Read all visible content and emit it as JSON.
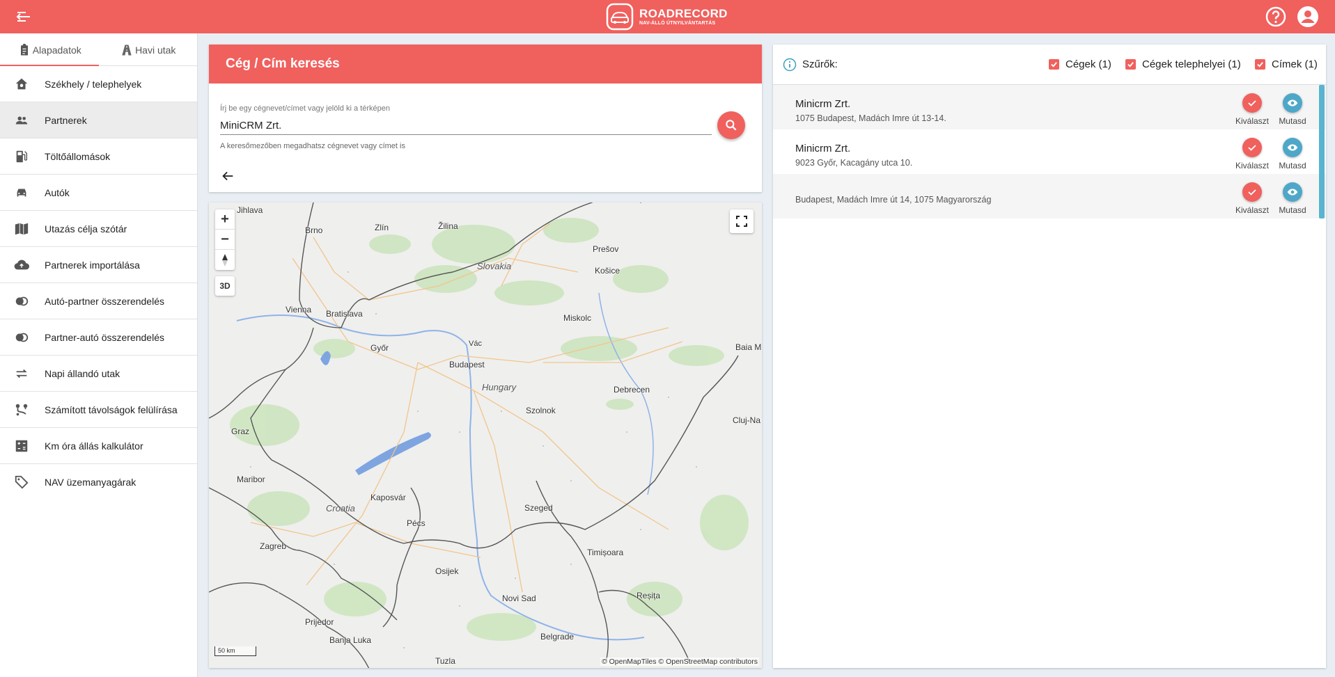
{
  "header": {
    "brand_title": "ROADRECORD",
    "brand_subtitle": "NAV-ÁLLÓ ÚTNYILVÁNTARTÁS",
    "back_icon": "menu-collapse-icon",
    "help_icon": "help-circle-icon",
    "account_icon": "account-circle-icon",
    "accent_color": "#f0605d"
  },
  "sidebar": {
    "tabs": [
      {
        "label": "Alapadatok",
        "icon": "clipboard-icon",
        "active": true
      },
      {
        "label": "Havi utak",
        "icon": "road-icon",
        "active": false
      }
    ],
    "items": [
      {
        "label": "Székhely / telephelyek",
        "icon": "home-gear-icon"
      },
      {
        "label": "Partnerek",
        "icon": "people-icon",
        "active": true
      },
      {
        "label": "Töltőállomások",
        "icon": "fuel-icon"
      },
      {
        "label": "Autók",
        "icon": "car-icon"
      },
      {
        "label": "Utazás célja szótár",
        "icon": "book-icon"
      },
      {
        "label": "Partnerek importálása",
        "icon": "cloud-upload-icon"
      },
      {
        "label": "Autó-partner összerendelés",
        "icon": "link-circles-icon"
      },
      {
        "label": "Partner-autó összerendelés",
        "icon": "link-circles-icon"
      },
      {
        "label": "Napi állandó utak",
        "icon": "repeat-icon"
      },
      {
        "label": "Számított távolságok felülírása",
        "icon": "route-icon"
      },
      {
        "label": "Km óra állás kalkulátor",
        "icon": "calculator-icon"
      },
      {
        "label": "NAV üzemanyagárak",
        "icon": "tag-icon"
      }
    ]
  },
  "search": {
    "title": "Cég / Cím keresés",
    "hint": "Írj be egy cégnevet/címet vagy jelöld ki a térképen",
    "value": "MiniCRM Zrt.",
    "helper": "A keresőmezőben megadhatsz cégnevet vagy címet is"
  },
  "map": {
    "countries": [
      "Slovakia",
      "Hungary",
      "Croatia"
    ],
    "cities": [
      "Jihlava",
      "Brno",
      "Zlín",
      "Žilina",
      "Prešov",
      "Košice",
      "Vienna",
      "Bratislava",
      "Miskolc",
      "Vác",
      "Győr",
      "Budapest",
      "Debrecen",
      "Baia M",
      "Graz",
      "Hungary",
      "Szolnok",
      "Cluj-Na",
      "Maribor",
      "Kaposvár",
      "Pécs",
      "Szeged",
      "Zagreb",
      "Timișoara",
      "Osijek",
      "Reșița",
      "Novi Sad",
      "Prijedor",
      "Banja Luka",
      "Belgrade",
      "Tuzla"
    ],
    "zoom_in": "+",
    "zoom_out": "−",
    "btn_3d": "3D",
    "scale": "50 km",
    "attribution": "© OpenMapTiles © OpenStreetMap contributors"
  },
  "filters": {
    "title": "Szűrők:",
    "options": [
      {
        "label": "Cégek (1)",
        "checked": true
      },
      {
        "label": "Cégek telephelyei (1)",
        "checked": true
      },
      {
        "label": "Címek (1)",
        "checked": true
      }
    ]
  },
  "results": [
    {
      "name": "Minicrm Zrt.",
      "address": "1075 Budapest, Madách Imre út 13-14.",
      "select": "Kiválaszt",
      "show": "Mutasd"
    },
    {
      "name": "Minicrm Zrt.",
      "address": "9023 Győr, Kacagány utca 10.",
      "select": "Kiválaszt",
      "show": "Mutasd"
    },
    {
      "name": "",
      "address": "Budapest, Madách Imre út 14, 1075 Magyarország",
      "select": "Kiválaszt",
      "show": "Mutasd"
    }
  ]
}
